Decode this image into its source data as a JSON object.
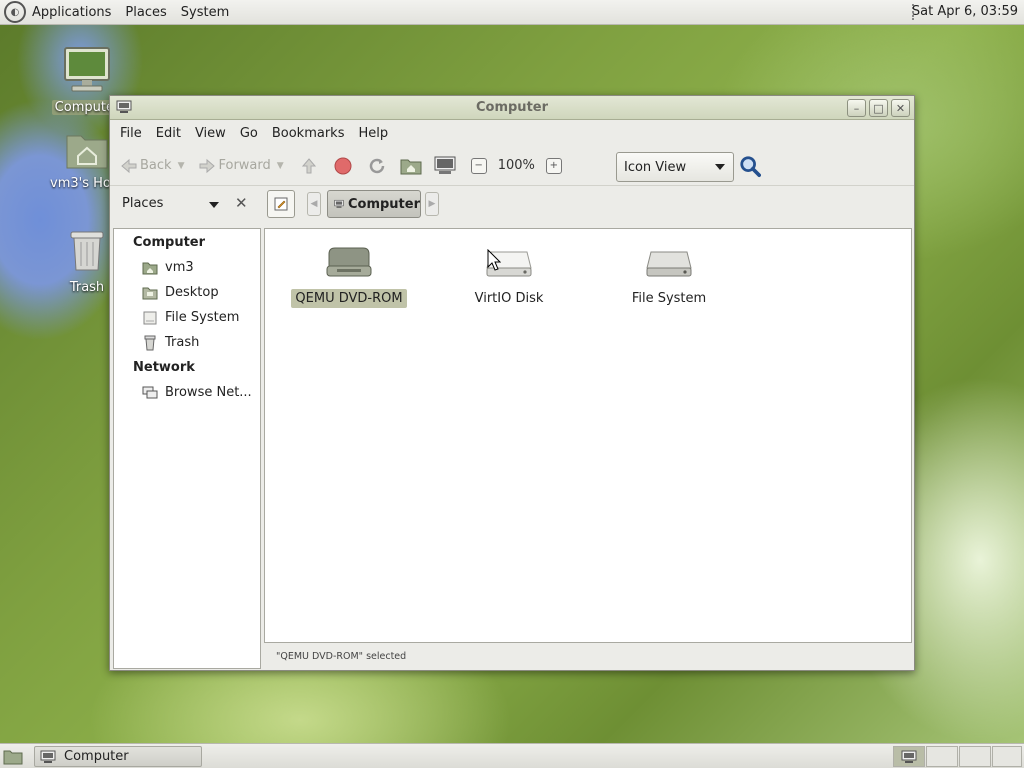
{
  "top_panel": {
    "menus": [
      "Applications",
      "Places",
      "System"
    ],
    "clock": "Sat Apr  6, 03:59"
  },
  "desktop_icons": [
    {
      "label": "Computer",
      "icon": "computer-icon"
    },
    {
      "label": "vm3's Home",
      "icon": "home-folder-icon"
    },
    {
      "label": "Trash",
      "icon": "trash-icon"
    }
  ],
  "window": {
    "title": "Computer",
    "menubar": [
      "File",
      "Edit",
      "View",
      "Go",
      "Bookmarks",
      "Help"
    ],
    "toolbar": {
      "back": "Back",
      "forward": "Forward",
      "zoom": "100%",
      "view_mode": "Icon View"
    },
    "location": {
      "side_pane_mode": "Places",
      "crumb": "Computer"
    },
    "sidebar": {
      "computer_header": "Computer",
      "computer_items": [
        {
          "label": "vm3",
          "icon": "home-folder-icon"
        },
        {
          "label": "Desktop",
          "icon": "desktop-folder-icon"
        },
        {
          "label": "File System",
          "icon": "drive-icon"
        },
        {
          "label": "Trash",
          "icon": "trash-icon"
        }
      ],
      "network_header": "Network",
      "network_items": [
        {
          "label": "Browse Net...",
          "icon": "network-icon"
        }
      ]
    },
    "items": [
      {
        "label": "QEMU DVD-ROM",
        "icon": "optical-drive-icon",
        "selected": true
      },
      {
        "label": "VirtIO Disk",
        "icon": "disk-icon",
        "selected": false
      },
      {
        "label": "File System",
        "icon": "hard-drive-icon",
        "selected": false
      }
    ],
    "status": "\"QEMU DVD-ROM\" selected"
  },
  "taskbar": {
    "task_label": "Computer"
  }
}
